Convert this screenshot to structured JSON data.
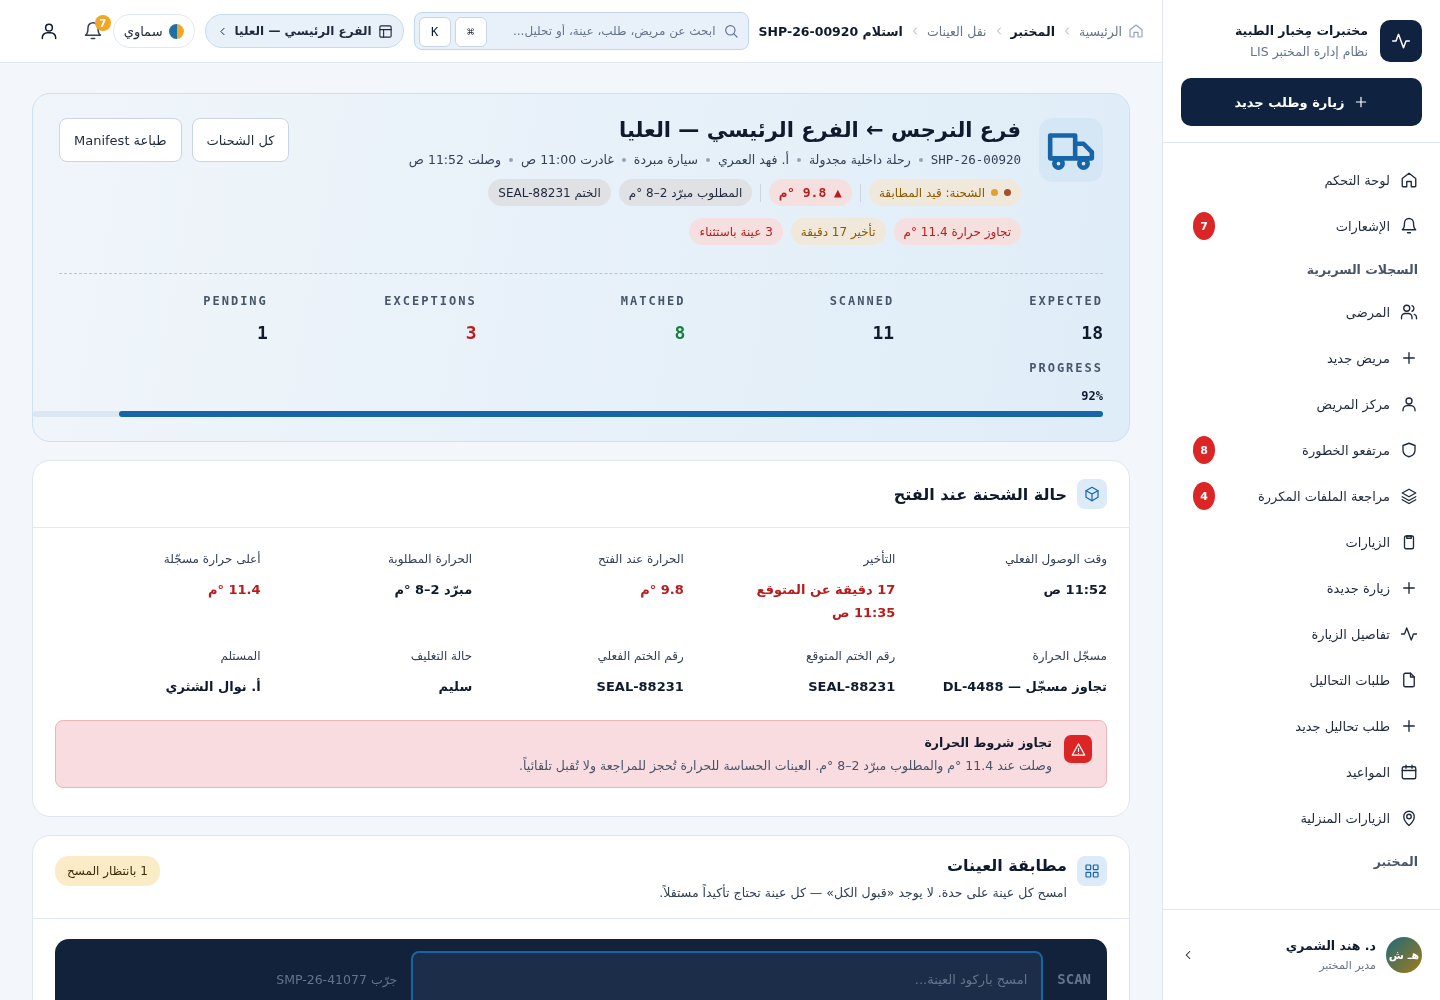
{
  "sidebar": {
    "brand_title": "مختبرات مِخبار الطبية",
    "brand_subtitle": "نظام إدارة المختبر LIS",
    "new_button": "زيارة وطلب جديد",
    "items": [
      {
        "kind": "item",
        "label": "لوحة التحكم"
      },
      {
        "kind": "item",
        "label": "الإشعارات",
        "badge": "7"
      },
      {
        "kind": "section",
        "label": "السجلات السريرية"
      },
      {
        "kind": "item",
        "label": "المرضى"
      },
      {
        "kind": "item",
        "label": "مريض جديد"
      },
      {
        "kind": "item",
        "label": "مركز المريض"
      },
      {
        "kind": "item",
        "label": "مرتفعو الخطورة",
        "badge": "8"
      },
      {
        "kind": "item",
        "label": "مراجعة الملفات المكررة",
        "badge": "4"
      },
      {
        "kind": "item",
        "label": "الزيارات"
      },
      {
        "kind": "item",
        "label": "زيارة جديدة"
      },
      {
        "kind": "item",
        "label": "تفاصيل الزيارة"
      },
      {
        "kind": "item",
        "label": "طلبات التحاليل"
      },
      {
        "kind": "item",
        "label": "طلب تحاليل جديد"
      },
      {
        "kind": "item",
        "label": "المواعيد"
      },
      {
        "kind": "item",
        "label": "الزيارات المنزلية"
      },
      {
        "kind": "section",
        "label": "المختبر"
      }
    ],
    "user": {
      "initials": "هـ ش",
      "name": "د. هند الشمري",
      "role": "مدير المختبر"
    }
  },
  "header": {
    "breadcrumbs": [
      {
        "label": "الرئيسية",
        "bold": false
      },
      {
        "label": "المختبر",
        "bold": true
      },
      {
        "label": "نقل العينات",
        "bold": false
      },
      {
        "label": "استلام SHP-26-00920",
        "bold": true
      }
    ],
    "search": {
      "placeholder": "ابحث عن مريض، طلب، عينة، أو تحليل...",
      "keys": [
        "⌘",
        "K"
      ]
    },
    "branch": "الفرع الرئيسي — العليا",
    "theme": "سماوي",
    "notifications": "7"
  },
  "shipment": {
    "title": "فرع النرجس ← الفرع الرئيسي — العليا",
    "meta": [
      "SHP-26-00920",
      "رحلة داخلية مجدولة",
      "أ. فهد العمري",
      "سيارة مبردة",
      "غادرت 11:00 ص",
      "وصلت 11:52 ص"
    ],
    "buttons": [
      "كل الشحنات",
      "طباعة Manifest"
    ],
    "chips": [
      {
        "kind": "status",
        "label": "الشحنة: قيد المطابقة",
        "color": "#8a5a00"
      },
      {
        "kind": "temp",
        "label": "▲ 9.8 °م",
        "color": "#b91c1c"
      },
      {
        "kind": "plain",
        "label": "المطلوب مبرّد 2–8 °م",
        "color": "#1e293b"
      },
      {
        "kind": "plain",
        "label": "الختم SEAL-88231",
        "color": "#1e293b"
      }
    ],
    "tags": [
      {
        "label": "تجاوز حرارة 11.4 °م",
        "color": "#b91c1c"
      },
      {
        "label": "تأخير 17 دقيقة",
        "color": "#8a5a00"
      },
      {
        "label": "3 عينة باستثناء",
        "color": "#b91c1c"
      }
    ],
    "stats": [
      {
        "label": "EXPECTED",
        "value": "18",
        "color": "#0f1b2d"
      },
      {
        "label": "SCANNED",
        "value": "11",
        "color": "#0f1b2d"
      },
      {
        "label": "MATCHED",
        "value": "8",
        "color": "#15803d"
      },
      {
        "label": "EXCEPTIONS",
        "value": "3",
        "color": "#b91c1c"
      },
      {
        "label": "PENDING",
        "value": "1",
        "color": "#0f1b2d"
      }
    ],
    "progress": {
      "label": "PROGRESS",
      "reading": "92%",
      "level": 0.92
    }
  },
  "arrival": {
    "title": "حالة الشحنة عند الفتح",
    "fields": [
      {
        "label": "وقت الوصول الفعلي",
        "value": "11:52 ص",
        "alert": false
      },
      {
        "label": "التأخير",
        "value": "17 دقيقة عن المتوقع 11:35 ص",
        "alert": true
      },
      {
        "label": "الحرارة عند الفتح",
        "value": "9.8 °م",
        "alert": true
      },
      {
        "label": "الحرارة المطلوبة",
        "value": "مبرّد 2–8 °م",
        "alert": false
      },
      {
        "label": "أعلى حرارة مسجّلة",
        "value": "11.4 °م",
        "alert": true
      },
      {
        "label": "مسجّل الحرارة",
        "value": "تجاوز مسجّل — DL-4488",
        "alert": false
      },
      {
        "label": "رقم الختم المتوقع",
        "value": "SEAL-88231",
        "alert": false
      },
      {
        "label": "رقم الختم الفعلي",
        "value": "SEAL-88231",
        "alert": false
      },
      {
        "label": "حالة التغليف",
        "value": "سليم",
        "alert": false
      },
      {
        "label": "المستلم",
        "value": "أ. نوال الشثري",
        "alert": false
      }
    ],
    "alert": {
      "title": "تجاوز شروط الحرارة",
      "text": "وصلت عند 11.4 °م والمطلوب مبرّد 2–8 °م. العينات الحساسة للحرارة تُحجز للمراجعة ولا تُقبل تلقائياً."
    }
  },
  "matching": {
    "title": "مطابقة العينات",
    "subtitle": "امسح كل عينة على حدة. لا يوجد «قبول الكل» — كل عينة تحتاج تأكيداً مستقلاً.",
    "pending_badge": "1 بانتظار المسح",
    "scan": {
      "label": "SCAN",
      "placeholder": "امسح باركود العينة...",
      "hint": "جرّب SMP-26-41077"
    }
  }
}
